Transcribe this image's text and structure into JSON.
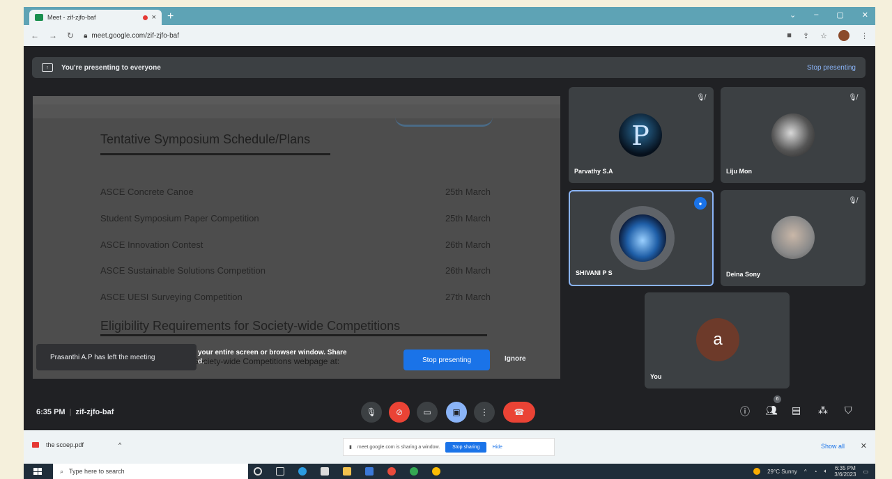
{
  "browser": {
    "tab_title": "Meet - zif-zjfo-baf",
    "tab_close": "×",
    "new_tab": "+",
    "url": "meet.google.com/zif-zjfo-baf",
    "window_controls": [
      "⌄",
      "–",
      "▢",
      "✕"
    ]
  },
  "banner": {
    "text": "You're presenting to everyone",
    "stop_label": "Stop presenting"
  },
  "shared": {
    "title": "Tentative Symposium Schedule/Plans",
    "rows": [
      {
        "event": "ASCE Concrete Canoe",
        "date": "25th March"
      },
      {
        "event": "Student Symposium Paper Competition",
        "date": "25th March"
      },
      {
        "event": "ASCE Innovation Contest",
        "date": "26th March"
      },
      {
        "event": "ASCE Sustainable Solutions Competition",
        "date": "26th March"
      },
      {
        "event": "ASCE UESI Surveying Competition",
        "date": "27th March"
      }
    ],
    "subtitle": "Eligibility Requirements for Society-wide Competitions",
    "faded_text": "Society-wide Competitions webpage at:",
    "hint_line1": "your entire screen or browser window. Share",
    "hint_line2": "d."
  },
  "toast": {
    "text": "Prasanthi A.P has left the meeting"
  },
  "share_prompt": {
    "stop_label": "Stop presenting",
    "ignore_label": "Ignore"
  },
  "participants": [
    {
      "name": "Parvathy S.A"
    },
    {
      "name": "Liju Mon"
    },
    {
      "name": "SHIVANI P S"
    },
    {
      "name": "Deina Sony"
    },
    {
      "name": "You",
      "initial": "a"
    }
  ],
  "meeting": {
    "time": "6:35 PM",
    "separator": "|",
    "code": "zif-zjfo-baf",
    "people_count": "6"
  },
  "downloads": {
    "file": "the scoep.pdf",
    "sharing_text": "meet.google.com is sharing a window.",
    "stop_sharing": "Stop sharing",
    "hide": "Hide",
    "show_all": "Show all",
    "close": "✕"
  },
  "taskbar": {
    "search_placeholder": "Type here to search",
    "weather": "29°C Sunny",
    "time": "6:35 PM",
    "date": "3/6/2023"
  },
  "colors": {
    "meet_bg": "#202124",
    "tile_bg": "#3c4043",
    "accent_blue": "#1a73e8",
    "end_red": "#ea4335",
    "chrome_teal": "#5ea3b5"
  }
}
